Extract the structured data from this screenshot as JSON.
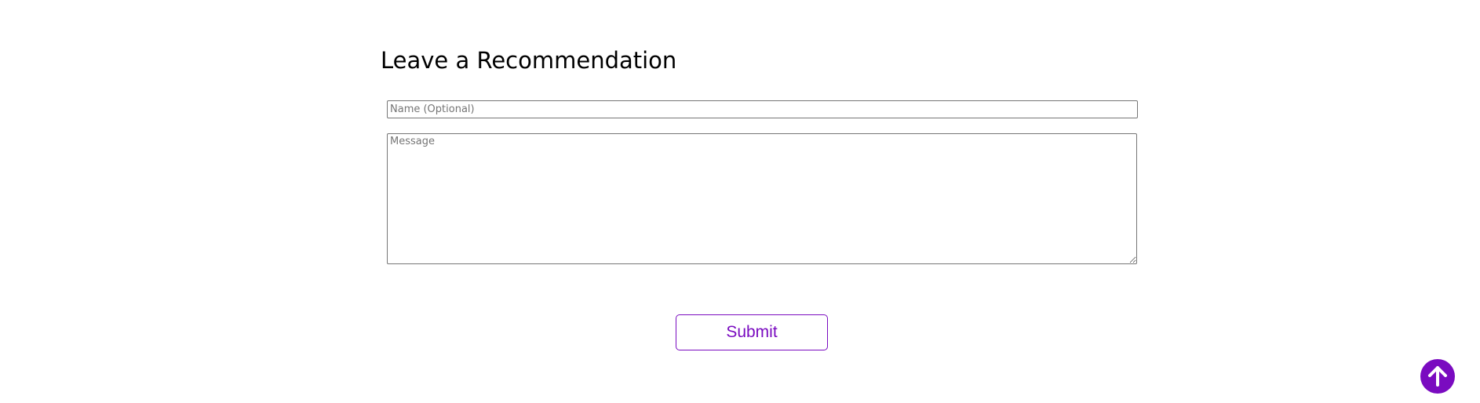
{
  "section": {
    "title": "Leave a Recommendation"
  },
  "form": {
    "name_placeholder": "Name (Optional)",
    "name_value": "",
    "message_placeholder": "Message",
    "message_value": "",
    "submit_label": "Submit"
  },
  "scroll_top": {
    "icon": "arrow-up-icon"
  },
  "colors": {
    "accent": "#7a0bc0",
    "input_border": "#767676",
    "background": "#ffffff"
  }
}
